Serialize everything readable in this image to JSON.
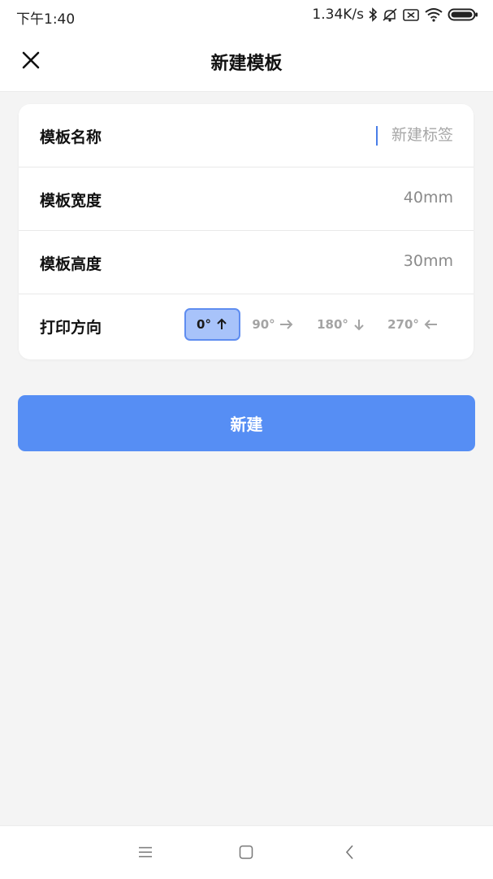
{
  "status_bar": {
    "time": "下午1:40",
    "network_speed": "1.34K/s",
    "icons": [
      "bluetooth-icon",
      "alarm-off-icon",
      "sim-icon",
      "wifi-icon",
      "battery-icon"
    ]
  },
  "header": {
    "title": "新建模板",
    "close_icon": "close-icon"
  },
  "form": {
    "name": {
      "label": "模板名称",
      "value": "",
      "placeholder": "新建标签"
    },
    "width": {
      "label": "模板宽度",
      "value": "40mm"
    },
    "height": {
      "label": "模板高度",
      "value": "30mm"
    },
    "orientation": {
      "label": "打印方向",
      "selected": "0°",
      "options": [
        {
          "label": "0°",
          "icon": "arrow-up-icon"
        },
        {
          "label": "90°",
          "icon": "arrow-right-icon"
        },
        {
          "label": "180°",
          "icon": "arrow-down-icon"
        },
        {
          "label": "270°",
          "icon": "arrow-left-icon"
        }
      ]
    }
  },
  "create_button": {
    "label": "新建"
  },
  "nav_bar": {
    "icons": [
      "menu-icon",
      "home-icon",
      "back-icon"
    ]
  },
  "colors": {
    "accent": "#568ef4",
    "selected_bg": "#a8c3fa",
    "selected_border": "#5f8df0",
    "page_bg": "#f4f4f4"
  }
}
